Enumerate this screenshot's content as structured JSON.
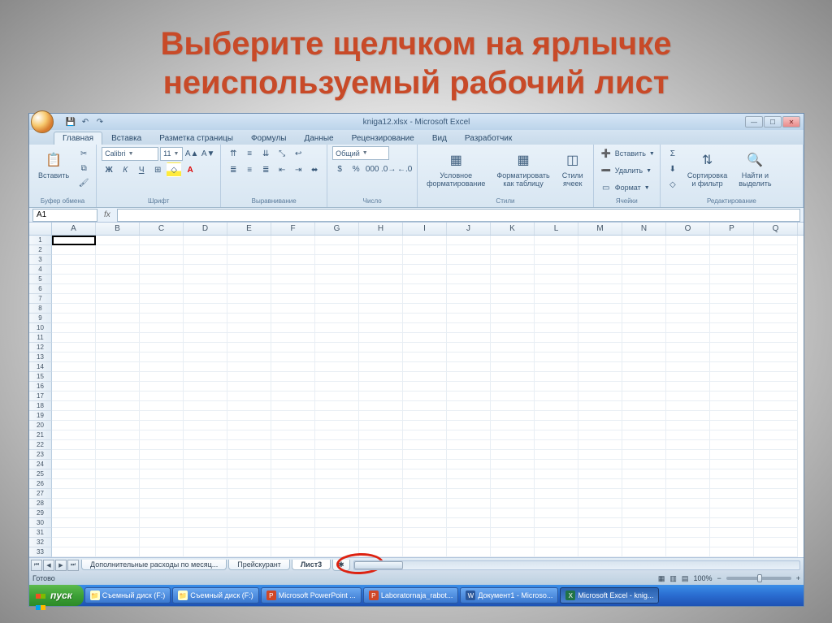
{
  "slide": {
    "title_line1": "Выберите щелчком на ярлычке",
    "title_line2": "неиспользуемый рабочий лист"
  },
  "window": {
    "title": "kniga12.xlsx - Microsoft Excel"
  },
  "ribbon_tabs": {
    "t0": "Главная",
    "t1": "Вставка",
    "t2": "Разметка страницы",
    "t3": "Формулы",
    "t4": "Данные",
    "t5": "Рецензирование",
    "t6": "Вид",
    "t7": "Разработчик"
  },
  "groups": {
    "clipboard": {
      "label": "Буфер обмена",
      "paste": "Вставить"
    },
    "font": {
      "label": "Шрифт",
      "name": "Calibri",
      "size": "11"
    },
    "alignment": {
      "label": "Выравнивание"
    },
    "number": {
      "label": "Число",
      "format": "Общий"
    },
    "styles": {
      "label": "Стили",
      "cond": "Условное\nформатирование",
      "table": "Форматировать\nкак таблицу",
      "cell": "Стили\nячеек"
    },
    "cells": {
      "label": "Ячейки",
      "insert": "Вставить",
      "delete": "Удалить",
      "format": "Формат"
    },
    "editing": {
      "label": "Редактирование",
      "sort": "Сортировка\nи фильтр",
      "find": "Найти и\nвыделить"
    }
  },
  "formula": {
    "name_box": "A1"
  },
  "columns": [
    "A",
    "B",
    "C",
    "D",
    "E",
    "F",
    "G",
    "H",
    "I",
    "J",
    "K",
    "L",
    "M",
    "N",
    "O",
    "P",
    "Q"
  ],
  "sheet_tabs": {
    "s0": "Дополнительные расходы по месяц...",
    "s1": "Прейскурант",
    "s2": "Лист3"
  },
  "status": {
    "ready": "Готово",
    "zoom": "100%"
  },
  "taskbar": {
    "start": "пуск",
    "t0": "Съемный диск (F:)",
    "t1": "Съемный диск (F:)",
    "t2": "Microsoft PowerPoint ...",
    "t3": "Laboratornaja_rabot...",
    "t4": "Документ1 - Microso...",
    "t5": "Microsoft Excel - knig..."
  }
}
